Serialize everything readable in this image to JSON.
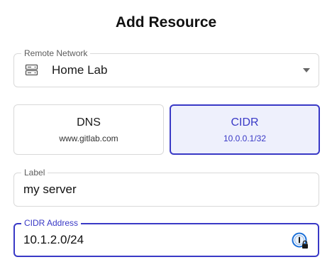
{
  "dialog": {
    "title": "Add Resource"
  },
  "remote_network": {
    "label": "Remote Network",
    "value": "Home Lab",
    "icon": "server-icon",
    "dropdown_icon": "chevron-down-icon"
  },
  "address_type": {
    "options": [
      {
        "title": "DNS",
        "example": "www.gitlab.com",
        "selected": false
      },
      {
        "title": "CIDR",
        "example": "10.0.0.1/32",
        "selected": true
      }
    ]
  },
  "label_field": {
    "label": "Label",
    "value": "my server"
  },
  "cidr_field": {
    "label": "CIDR Address",
    "value": "10.1.2.0/24",
    "icon": "password-manager-icon"
  },
  "colors": {
    "accent": "#3939c6",
    "selected_bg": "#eef0fc",
    "border": "#d9d9d9"
  }
}
